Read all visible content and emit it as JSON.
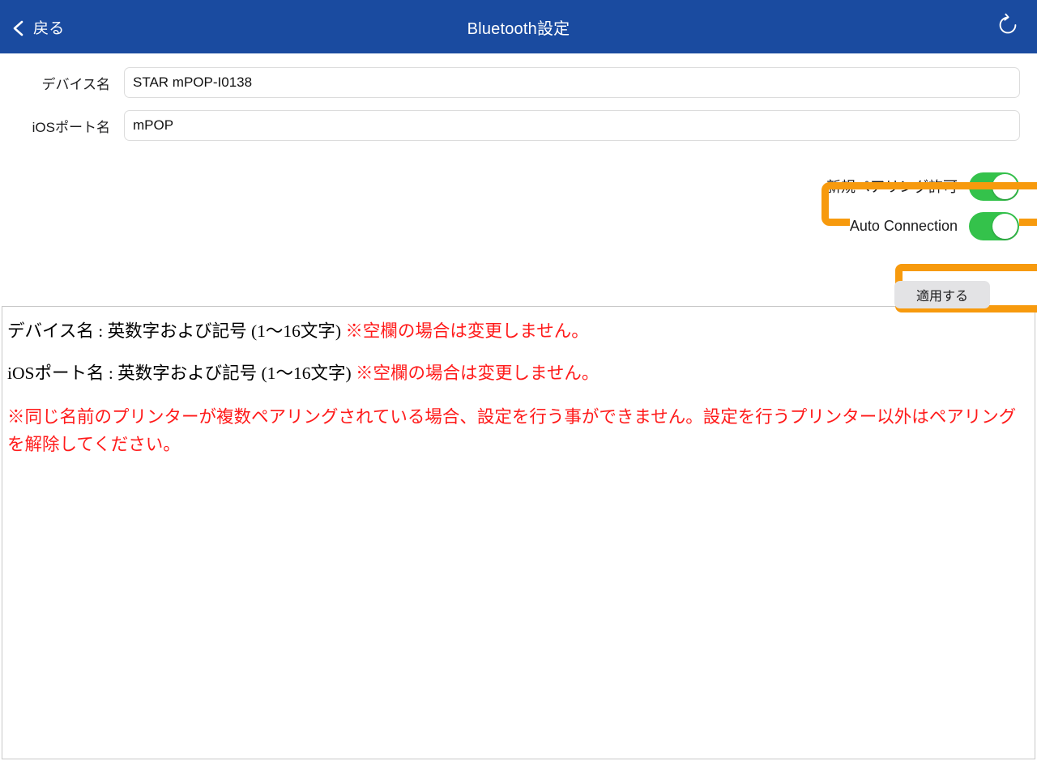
{
  "header": {
    "back_label": "戻る",
    "back_icon": "chevron-left-icon",
    "title": "Bluetooth設定",
    "refresh_icon": "refresh-icon",
    "background_color": "#1a4ba0"
  },
  "form": {
    "device_name": {
      "label": "デバイス名",
      "value": "STAR mPOP-I0138",
      "placeholder": ""
    },
    "ios_port_name": {
      "label": "iOSポート名",
      "value": "mPOP",
      "placeholder": ""
    }
  },
  "toggles": {
    "new_pairing": {
      "label": "新規ペアリング許可",
      "state": "on",
      "color": "#34c24b"
    },
    "auto_connection": {
      "label": "Auto Connection",
      "state": "on",
      "color": "#34c24b"
    }
  },
  "actions": {
    "apply_label": "適用する"
  },
  "highlight": {
    "color": "#f79a0d"
  },
  "notes": {
    "line1_black": "デバイス名 : 英数字および記号 (1〜16文字)",
    "line1_red": "※空欄の場合は変更しません。",
    "line2_black": "iOSポート名 : 英数字および記号 (1〜16文字)",
    "line2_red": "※空欄の場合は変更しません。",
    "paragraph_red": "※同じ名前のプリンターが複数ペアリングされている場合、設定を行う事ができません。設定を行うプリンター以外はペアリングを解除してください。"
  }
}
